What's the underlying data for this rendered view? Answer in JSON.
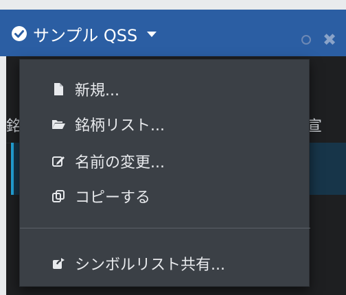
{
  "header": {
    "title": "サンプル QSS"
  },
  "background": {
    "left_fragment": "銘",
    "right_fragment": "宣"
  },
  "menu": {
    "items": [
      {
        "label": "新規...",
        "icon": "file-icon"
      },
      {
        "label": "銘柄リスト...",
        "icon": "folder-open-icon"
      },
      {
        "label": "名前の変更...",
        "icon": "edit-icon"
      },
      {
        "label": "コピーする",
        "icon": "copy-icon"
      },
      {
        "label": "シンボルリスト共有...",
        "icon": "share-icon"
      }
    ]
  },
  "colors": {
    "titlebar": "#2b5ea3",
    "menu_background": "#3b4046",
    "panel_background": "#1e1f21",
    "accent": "#23a3d9"
  }
}
